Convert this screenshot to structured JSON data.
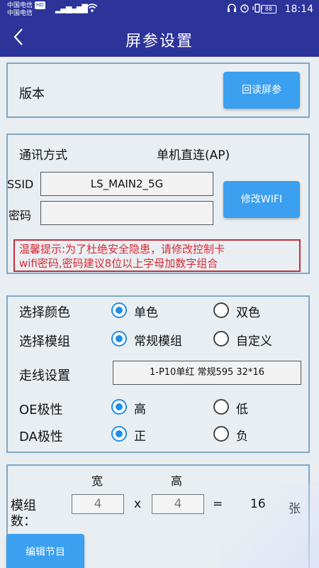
{
  "status_bar": {
    "carrier_1": "中国电信",
    "carrier_1_badge": "HD",
    "carrier_2": "中国电信",
    "battery": "88",
    "time": "18:14"
  },
  "title_bar": {
    "back_icon": "chevron-left-icon",
    "back_glyph": "<",
    "title": "屏参设置"
  },
  "version_card": {
    "label": "版本",
    "readback_button": "回读屏参"
  },
  "comm_card": {
    "mode_label": "通讯方式",
    "mode_value": "单机直连(AP)",
    "ssid_label": "SSID",
    "ssid_value": "LS_MAIN2_5G",
    "password_label": "密码",
    "password_value": "",
    "modify_wifi_button": "修改WIFI",
    "tip_line1": "温馨提示:为了杜绝安全隐患，请修改控制卡",
    "tip_line2": "wifi密码,密码建议8位以上字母加数字组合"
  },
  "settings_card": {
    "color_label": "选择颜色",
    "color_options": [
      "单色",
      "双色"
    ],
    "color_selected": "单色",
    "module_label": "选择模组",
    "module_options": [
      "常规模组",
      "自定义"
    ],
    "module_selected": "常规模组",
    "wiring_label": "走线设置",
    "wiring_value": "1-P10单红 常规595 32*16",
    "oe_label": "OE极性",
    "oe_options": [
      "高",
      "低"
    ],
    "oe_selected": "高",
    "da_label": "DA极性",
    "da_options": [
      "正",
      "负"
    ],
    "da_selected": "正"
  },
  "module_count_card": {
    "width_header": "宽",
    "height_header": "高",
    "label_line1": "模组",
    "label_line2": "数：",
    "width_value": "4",
    "times": "x",
    "height_value": "4",
    "equals": "=",
    "total": "16",
    "unit": "张"
  },
  "edit_program_button": "编辑节目"
}
